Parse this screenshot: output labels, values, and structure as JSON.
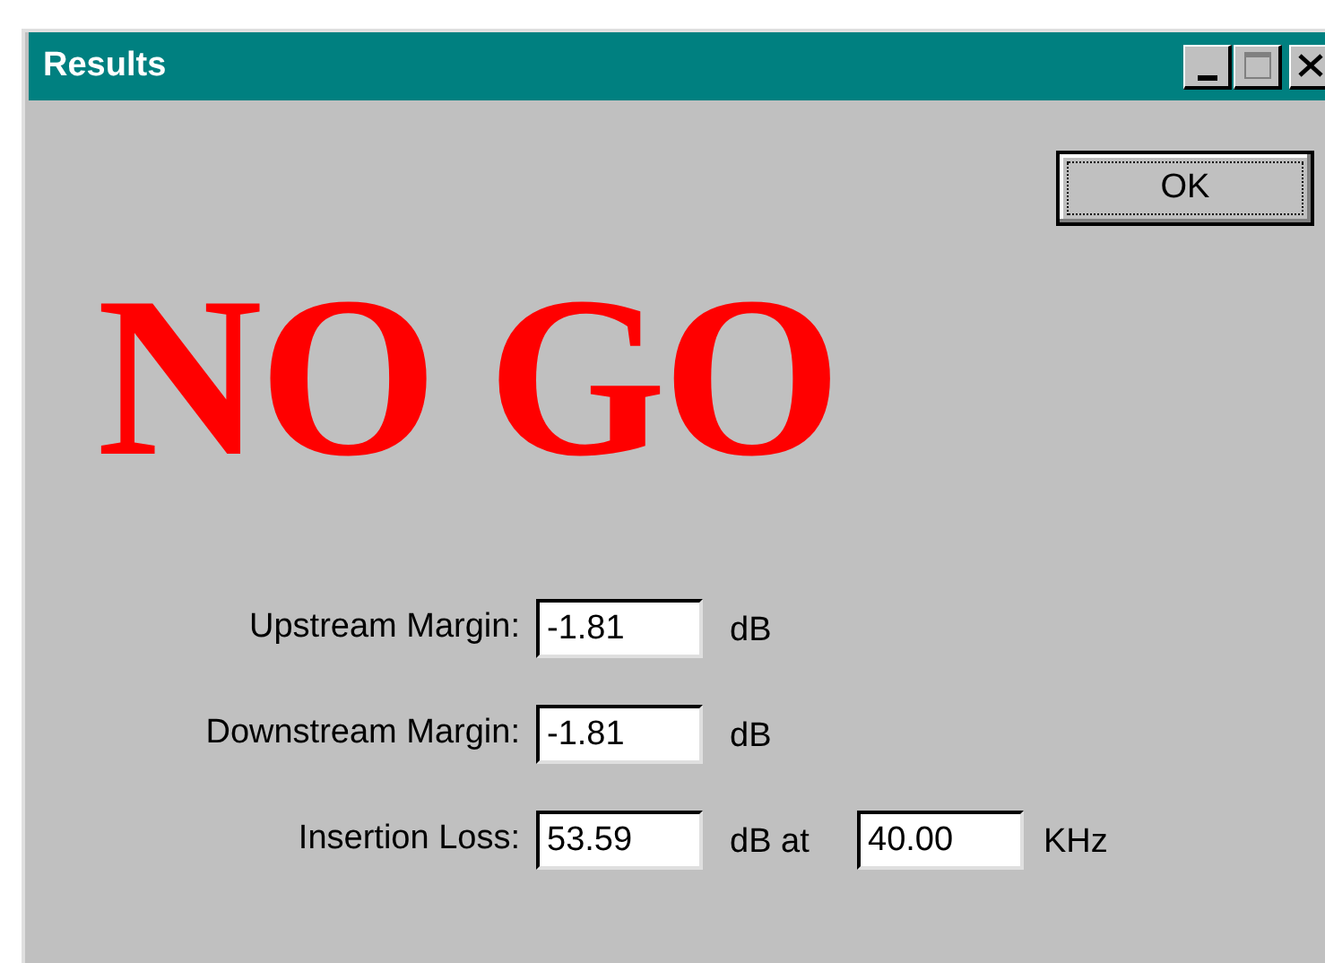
{
  "window": {
    "title": "Results"
  },
  "ok_button": {
    "label": "OK"
  },
  "verdict": "NO GO",
  "measurements": [
    {
      "label": "Upstream Margin:",
      "value": "-1.81",
      "unit": "dB"
    },
    {
      "label": "Downstream Margin:",
      "value": "-1.81",
      "unit": "dB"
    },
    {
      "label": "Insertion Loss:",
      "value": "53.59",
      "unit": "dB at",
      "frequency": {
        "value": "40.00",
        "unit": "KHz"
      }
    }
  ]
}
